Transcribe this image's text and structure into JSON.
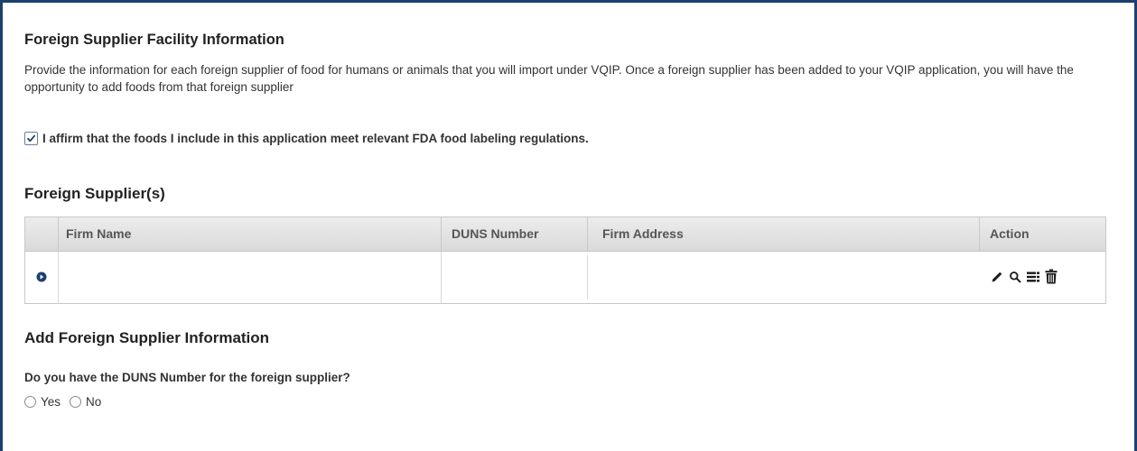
{
  "facility": {
    "title": "Foreign Supplier Facility Information",
    "description": "Provide the information for each foreign supplier of food for humans or animals that you will import under VQIP. Once a foreign supplier has been added to your VQIP application, you will have the opportunity to add foods from that foreign supplier",
    "affirm": {
      "checked": true,
      "label": "I affirm that the foods I include in this application meet relevant FDA food labeling regulations."
    }
  },
  "suppliers": {
    "title": "Foreign Supplier(s)",
    "columns": [
      "Firm Name",
      "DUNS Number",
      "Firm Address",
      "Action"
    ],
    "rows": [
      {
        "firm_name": "",
        "duns_number": "",
        "firm_address": ""
      }
    ],
    "actions": [
      "edit-icon",
      "search-icon",
      "list-icon",
      "trash-icon"
    ]
  },
  "add_supplier": {
    "title": "Add Foreign Supplier Information",
    "question": "Do you have the DUNS Number for the foreign supplier?",
    "options": [
      "Yes",
      "No"
    ]
  },
  "colors": {
    "frame_border": "#1c3f6e",
    "checkmark": "#1c3f6e",
    "icon": "#1a1a1a"
  }
}
